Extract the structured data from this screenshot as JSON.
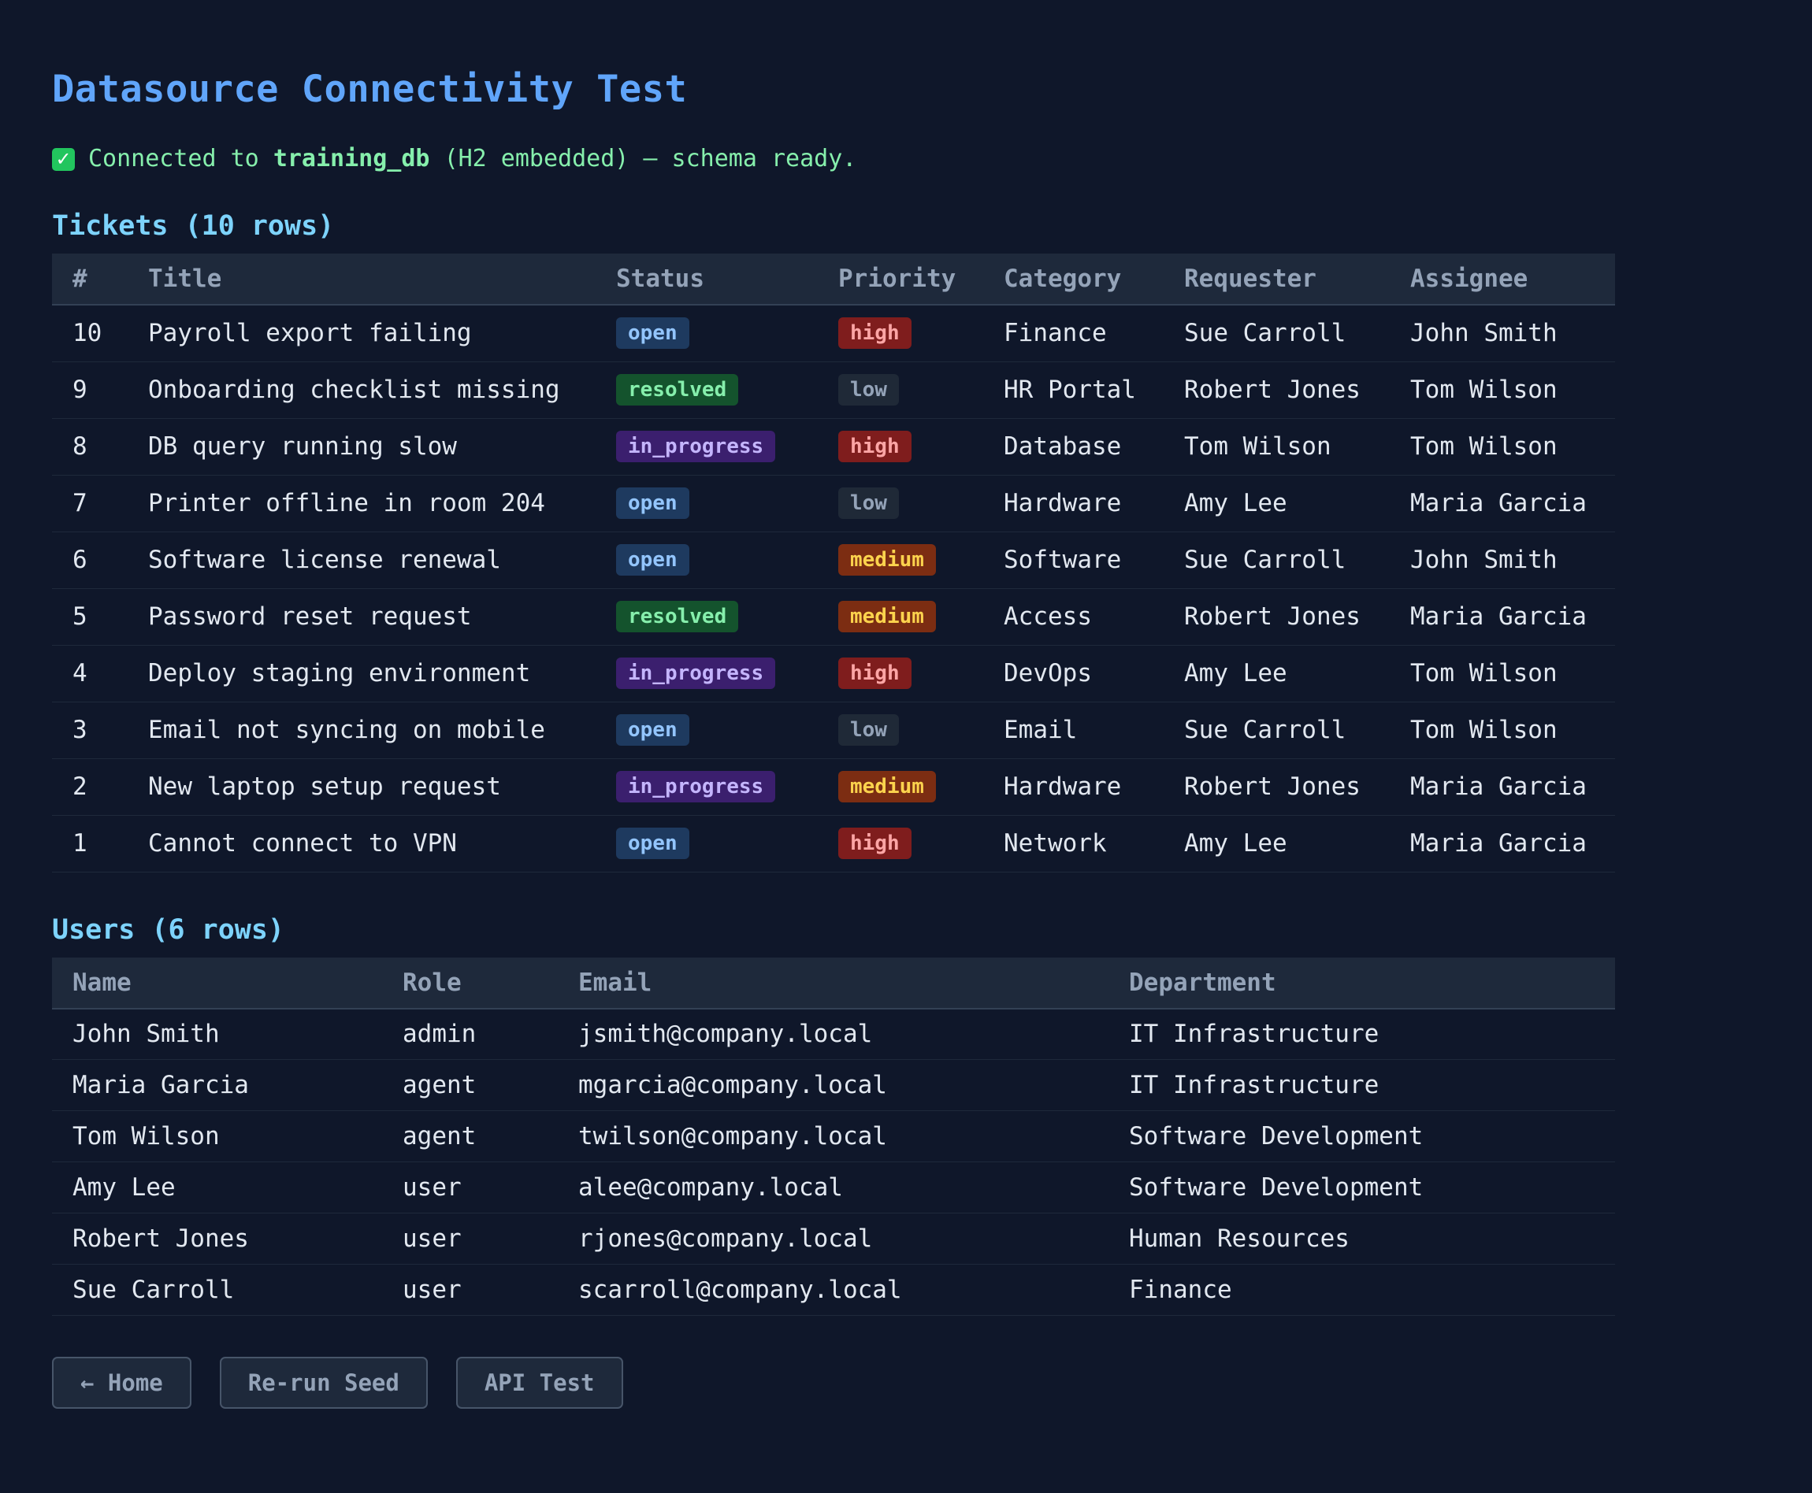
{
  "page": {
    "title": "Datasource Connectivity Test",
    "status_icon": "check-mark-icon",
    "status_prefix": "Connected to",
    "status_db": "training_db",
    "status_suffix": "(H2 embedded) — schema ready."
  },
  "tickets": {
    "heading": "Tickets (10 rows)",
    "columns": [
      "#",
      "Title",
      "Status",
      "Priority",
      "Category",
      "Requester",
      "Assignee"
    ],
    "rows": [
      {
        "id": "10",
        "title": "Payroll export failing",
        "status": "open",
        "priority": "high",
        "category": "Finance",
        "requester": "Sue Carroll",
        "assignee": "John Smith"
      },
      {
        "id": "9",
        "title": "Onboarding checklist missing",
        "status": "resolved",
        "priority": "low",
        "category": "HR Portal",
        "requester": "Robert Jones",
        "assignee": "Tom Wilson"
      },
      {
        "id": "8",
        "title": "DB query running slow",
        "status": "in_progress",
        "priority": "high",
        "category": "Database",
        "requester": "Tom Wilson",
        "assignee": "Tom Wilson"
      },
      {
        "id": "7",
        "title": "Printer offline in room 204",
        "status": "open",
        "priority": "low",
        "category": "Hardware",
        "requester": "Amy Lee",
        "assignee": "Maria Garcia"
      },
      {
        "id": "6",
        "title": "Software license renewal",
        "status": "open",
        "priority": "medium",
        "category": "Software",
        "requester": "Sue Carroll",
        "assignee": "John Smith"
      },
      {
        "id": "5",
        "title": "Password reset request",
        "status": "resolved",
        "priority": "medium",
        "category": "Access",
        "requester": "Robert Jones",
        "assignee": "Maria Garcia"
      },
      {
        "id": "4",
        "title": "Deploy staging environment",
        "status": "in_progress",
        "priority": "high",
        "category": "DevOps",
        "requester": "Amy Lee",
        "assignee": "Tom Wilson"
      },
      {
        "id": "3",
        "title": "Email not syncing on mobile",
        "status": "open",
        "priority": "low",
        "category": "Email",
        "requester": "Sue Carroll",
        "assignee": "Tom Wilson"
      },
      {
        "id": "2",
        "title": "New laptop setup request",
        "status": "in_progress",
        "priority": "medium",
        "category": "Hardware",
        "requester": "Robert Jones",
        "assignee": "Maria Garcia"
      },
      {
        "id": "1",
        "title": "Cannot connect to VPN",
        "status": "open",
        "priority": "high",
        "category": "Network",
        "requester": "Amy Lee",
        "assignee": "Maria Garcia"
      }
    ]
  },
  "users": {
    "heading": "Users (6 rows)",
    "columns": [
      "Name",
      "Role",
      "Email",
      "Department"
    ],
    "rows": [
      {
        "name": "John Smith",
        "role": "admin",
        "email": "jsmith@company.local",
        "department": "IT Infrastructure"
      },
      {
        "name": "Maria Garcia",
        "role": "agent",
        "email": "mgarcia@company.local",
        "department": "IT Infrastructure"
      },
      {
        "name": "Tom Wilson",
        "role": "agent",
        "email": "twilson@company.local",
        "department": "Software Development"
      },
      {
        "name": "Amy Lee",
        "role": "user",
        "email": "alee@company.local",
        "department": "Software Development"
      },
      {
        "name": "Robert Jones",
        "role": "user",
        "email": "rjones@company.local",
        "department": "Human Resources"
      },
      {
        "name": "Sue Carroll",
        "role": "user",
        "email": "scarroll@company.local",
        "department": "Finance"
      }
    ]
  },
  "buttons": {
    "home": "← Home",
    "reseed": "Re-run Seed",
    "api": "API Test"
  },
  "colors": {
    "background": "#0f172a",
    "title": "#60a5fa",
    "status_text": "#86efac",
    "section_heading": "#7dd3fc"
  }
}
